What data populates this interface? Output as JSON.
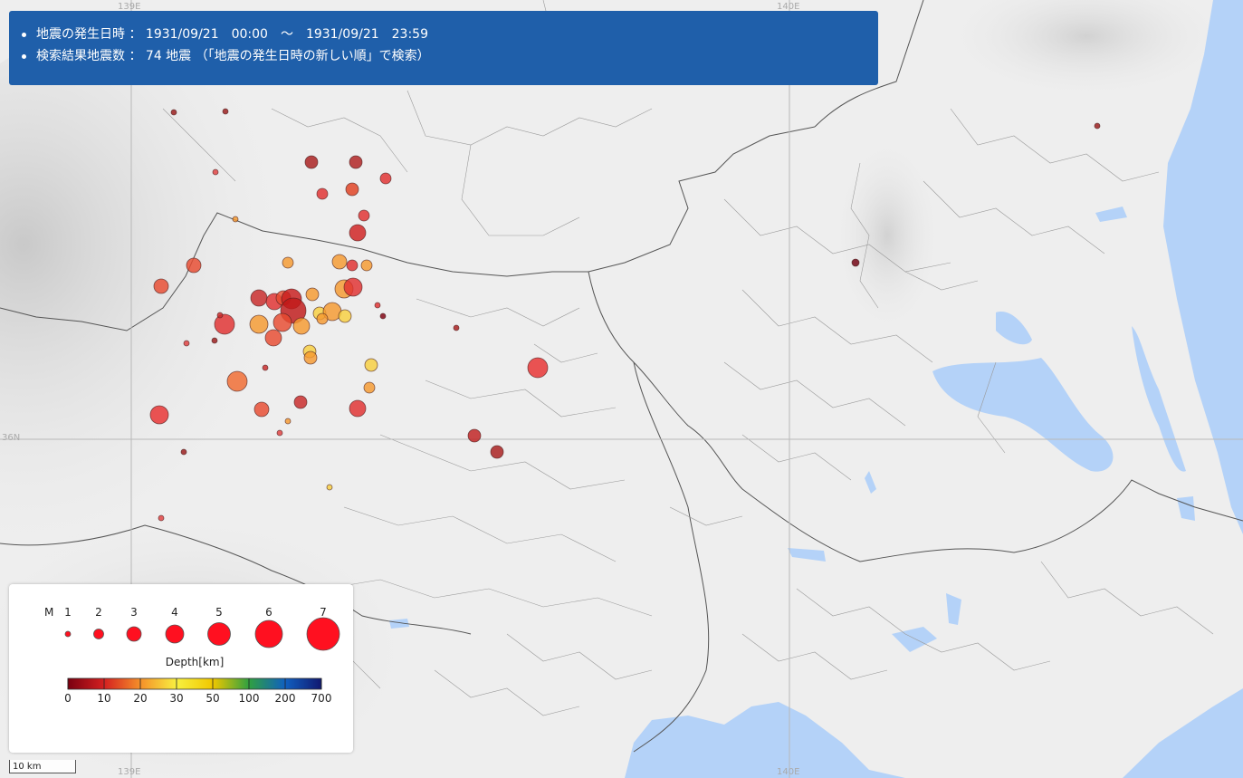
{
  "info": {
    "period_label": "地震の発生日時",
    "period_value": "1931/09/21　00:00　～　1931/09/21　23:59",
    "count_label": "検索結果地震数",
    "count_value": "74 地震 （「地震の発生日時の新しい順」で検索）"
  },
  "grid_labels": {
    "lon_left": "139E",
    "lon_right": "140E",
    "lat": "36N"
  },
  "legend": {
    "m_label": "M",
    "magnitudes": [
      "1",
      "2",
      "3",
      "4",
      "5",
      "6",
      "7"
    ],
    "depth_title": "Depth[km]",
    "depth_ticks": [
      "0",
      "10",
      "20",
      "30",
      "50",
      "100",
      "200",
      "700"
    ],
    "depth_colors": [
      "#7a0010",
      "#d42020",
      "#f5902a",
      "#f8f040",
      "#f0c800",
      "#30a040",
      "#1060c0",
      "#101870"
    ]
  },
  "scale_label": "10 km",
  "colors": {
    "header_bg": "#1f5faa",
    "water": "#b4d2f8",
    "land": "#eeeeee"
  }
}
